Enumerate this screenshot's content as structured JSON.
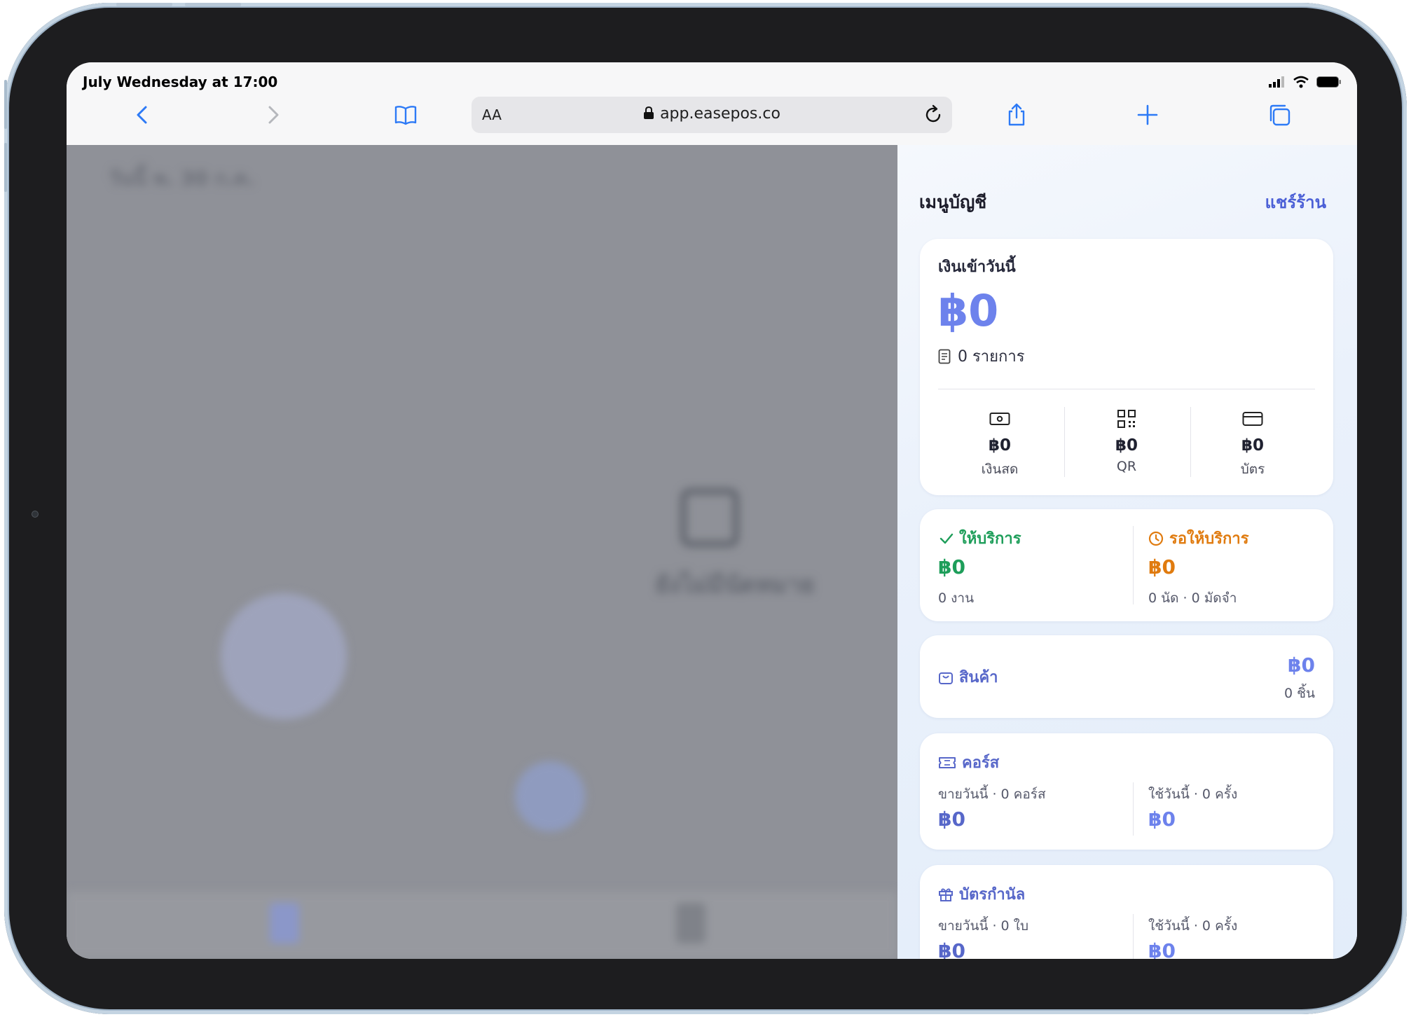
{
  "status_bar": {
    "time": "July Wednesday at 17:00"
  },
  "browser": {
    "text_size_label": "AA",
    "url": "app.easepos.co"
  },
  "backdrop": {
    "title": "วันนี้ พ. 30 ก.ค.",
    "empty_text": "ยังไม่มีนัดหมาย"
  },
  "panel": {
    "title": "เมนูบัญชี",
    "share_label": "แชร์ร้าน",
    "income": {
      "label": "เงินเข้าวันนี้",
      "amount": "฿0",
      "count": "0 รายการ",
      "methods": [
        {
          "icon": "cash-icon",
          "amount": "฿0",
          "label": "เงินสด"
        },
        {
          "icon": "qr-icon",
          "amount": "฿0",
          "label": "QR"
        },
        {
          "icon": "card-icon",
          "amount": "฿0",
          "label": "บัตร"
        }
      ]
    },
    "service": {
      "done_label": "ให้บริการ",
      "done_amount": "฿0",
      "done_sub": "0 งาน",
      "pending_label": "รอให้บริการ",
      "pending_amount": "฿0",
      "pending_sub": "0 นัด · 0 มัดจำ"
    },
    "products": {
      "label": "สินค้า",
      "amount": "฿0",
      "sub": "0 ชิ้น"
    },
    "courses": {
      "label": "คอร์ส",
      "sold_label": "ขายวันนี้ · 0 คอร์ส",
      "sold_amount": "฿0",
      "used_label": "ใช้วันนี้ · 0 ครั้ง",
      "used_amount": "฿0"
    },
    "vouchers": {
      "label": "บัตรกำนัล",
      "sold_label": "ขายวันนี้ · 0 ใบ",
      "sold_amount": "฿0",
      "used_label": "ใช้วันนี้ · 0 ครั้ง",
      "used_amount": "฿0"
    }
  },
  "colors": {
    "accent": "#6d82ec",
    "green": "#1e9e5a",
    "orange": "#e07b0f",
    "link": "#4b5fd6"
  }
}
